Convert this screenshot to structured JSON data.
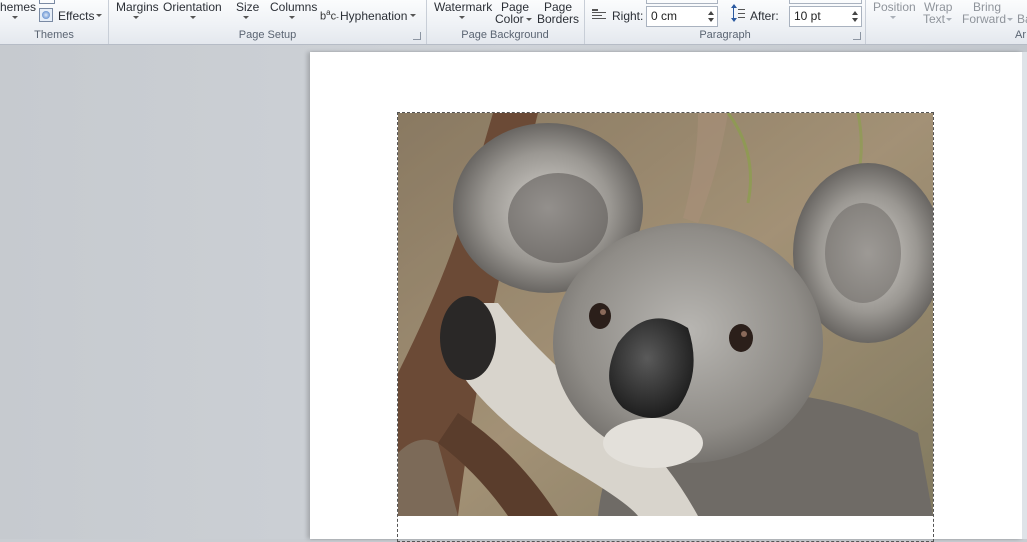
{
  "ribbon": {
    "themes": {
      "themes_label": "hemes",
      "effects_label": "Effects",
      "group_label": "Themes"
    },
    "page_setup": {
      "margins": "Margins",
      "orientation": "Orientation",
      "size": "Size",
      "columns": "Columns",
      "hyphenation": "Hyphenation",
      "group_label": "Page Setup"
    },
    "page_background": {
      "watermark": "Watermark",
      "page_color_1": "Page",
      "page_color_2": "Color",
      "page_borders_1": "Page",
      "page_borders_2": "Borders",
      "group_label": "Page Background"
    },
    "paragraph": {
      "right_label": "Right:",
      "right_value": "0 cm",
      "after_label": "After:",
      "after_value": "10 pt",
      "group_label": "Paragraph"
    },
    "arrange": {
      "position": "Position",
      "wrap_1": "Wrap",
      "wrap_2": "Text",
      "bring_1": "Bring",
      "bring_2": "Forward",
      "back_partial": "Ba",
      "group_label_partial": "Ar"
    }
  },
  "document": {
    "image_subject": "koala photo"
  },
  "colors": {
    "ribbon_bg": "#eef1f5",
    "workspace_bg": "#c9cdd2",
    "page_bg": "#ffffff"
  }
}
